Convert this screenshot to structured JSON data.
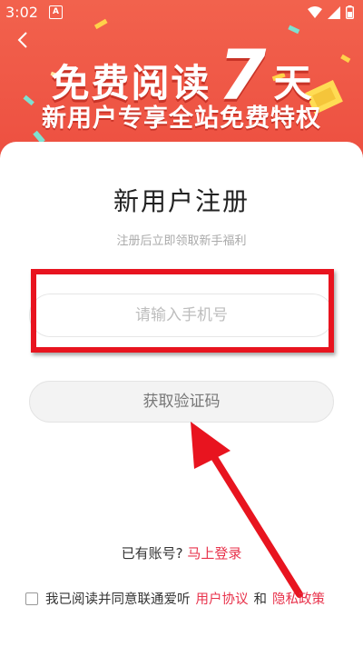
{
  "status_bar": {
    "time": "3:02",
    "notification_letter": "A"
  },
  "banner": {
    "headline_left": "免费阅读",
    "headline_number": "7",
    "headline_unit": "天",
    "subline": "新用户专享全站免费特权"
  },
  "form": {
    "title": "新用户注册",
    "subtitle": "注册后立即领取新手福利",
    "phone_placeholder": "请输入手机号",
    "get_code_label": "获取验证码"
  },
  "footer": {
    "have_account": "已有账号?",
    "login_link": "马上登录",
    "agree_prefix": "我已阅读并同意联通爱听",
    "user_agreement": "用户协议",
    "and": "和",
    "privacy_policy": "隐私政策"
  },
  "colors": {
    "banner": "#ec4d3f",
    "accent_link": "#e8324b",
    "annotation_red": "#e8141f"
  }
}
